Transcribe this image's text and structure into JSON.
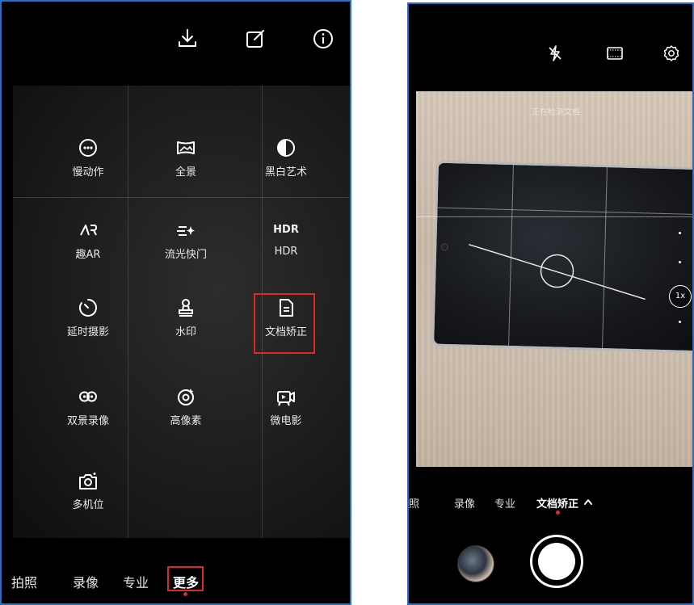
{
  "left_screen": {
    "top_icons": [
      "download-icon",
      "edit-icon",
      "info-icon"
    ],
    "modes": [
      {
        "label": "慢动作",
        "icon": "slow-motion-icon"
      },
      {
        "label": "全景",
        "icon": "panorama-icon"
      },
      {
        "label": "黑白艺术",
        "icon": "monochrome-icon"
      },
      {
        "label": "趣AR",
        "icon_text": "AR",
        "icon": "ar-icon"
      },
      {
        "label": "流光快门",
        "icon": "light-trail-icon"
      },
      {
        "label": "HDR",
        "icon_text": "HDR",
        "icon": "hdr-icon"
      },
      {
        "label": "延时摄影",
        "icon": "timelapse-icon"
      },
      {
        "label": "水印",
        "icon": "watermark-icon"
      },
      {
        "label": "文档矫正",
        "icon": "document-icon"
      },
      {
        "label": "双景录像",
        "icon": "dual-view-icon"
      },
      {
        "label": "高像素",
        "icon": "high-resolution-icon"
      },
      {
        "label": "微电影",
        "icon": "micro-movie-icon"
      },
      {
        "label": "多机位",
        "icon": "multi-camera-icon"
      }
    ],
    "highlighted_mode": "文档矫正",
    "bottom_tabs": [
      {
        "label": "拍照"
      },
      {
        "label": "录像"
      },
      {
        "label": "专业"
      },
      {
        "label": "更多",
        "active": true
      }
    ],
    "accent_color": "#e0262d",
    "frame_color": "#1f6fd6"
  },
  "right_screen": {
    "top_icons": [
      "flash-off-icon",
      "aspect-ratio-icon",
      "settings-icon"
    ],
    "detecting_text": "正在检测文档",
    "zoom_label": "1x",
    "mode_strip": [
      {
        "label": "拍照"
      },
      {
        "label": "录像"
      },
      {
        "label": "专业"
      },
      {
        "label": "文档矫正",
        "active": true
      }
    ],
    "mode_strip_expand_icon": "chevron-up-icon"
  }
}
